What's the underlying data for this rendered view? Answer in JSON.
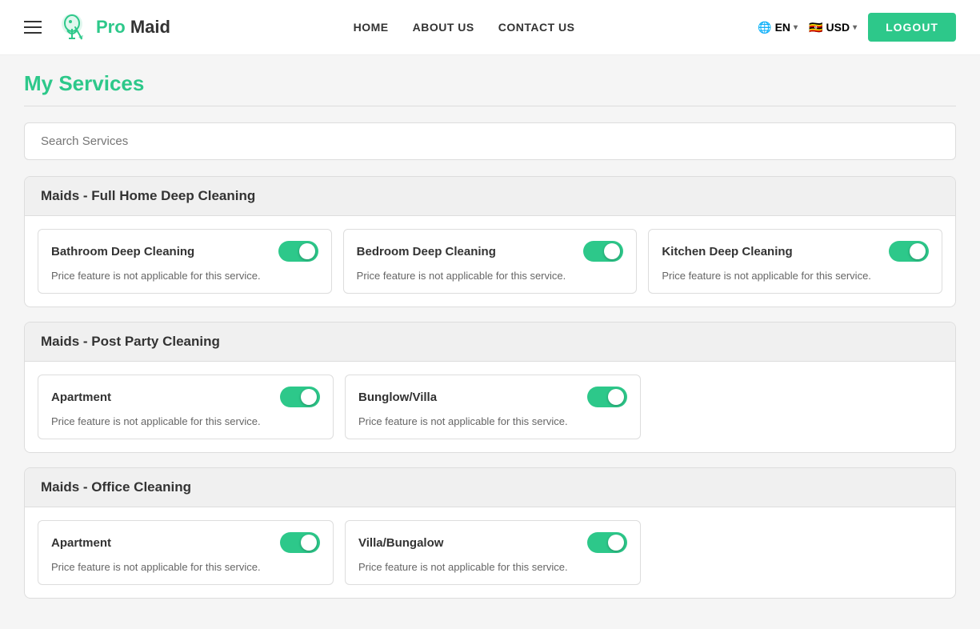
{
  "header": {
    "hamburger_label": "menu",
    "logo_text_1": "Pro",
    "logo_text_2": "Maid",
    "nav": [
      {
        "label": "HOME",
        "id": "nav-home"
      },
      {
        "label": "ABOUT US",
        "id": "nav-about"
      },
      {
        "label": "CONTACT US",
        "id": "nav-contact"
      }
    ],
    "lang": "EN",
    "lang_flag": "🌐",
    "currency": "USD",
    "currency_flag": "🇺🇬",
    "logout_label": "LOGOUT"
  },
  "page": {
    "title": "My Services",
    "search_placeholder": "Search Services"
  },
  "service_groups": [
    {
      "id": "group-full-home",
      "title": "Maids - Full Home Deep Cleaning",
      "items": [
        {
          "id": "bathroom-deep",
          "title": "Bathroom Deep Cleaning",
          "note": "Price feature is not applicable for this service.",
          "enabled": true
        },
        {
          "id": "bedroom-deep",
          "title": "Bedroom Deep Cleaning",
          "note": "Price feature is not applicable for this service.",
          "enabled": true
        },
        {
          "id": "kitchen-deep",
          "title": "Kitchen Deep Cleaning",
          "note": "Price feature is not applicable for this service.",
          "enabled": true
        }
      ]
    },
    {
      "id": "group-post-party",
      "title": "Maids - Post Party Cleaning",
      "items": [
        {
          "id": "apartment-party",
          "title": "Apartment",
          "note": "Price feature is not applicable for this service.",
          "enabled": true
        },
        {
          "id": "bungalow-party",
          "title": "Bunglow/Villa",
          "note": "Price feature is not applicable for this service.",
          "enabled": true
        }
      ]
    },
    {
      "id": "group-office",
      "title": "Maids - Office Cleaning",
      "items": [
        {
          "id": "apartment-office",
          "title": "Apartment",
          "note": "Price feature is not applicable for this service.",
          "enabled": true
        },
        {
          "id": "villa-office",
          "title": "Villa/Bungalow",
          "note": "Price feature is not applicable for this service.",
          "enabled": true
        }
      ]
    }
  ],
  "colors": {
    "brand_green": "#2dc88a"
  }
}
